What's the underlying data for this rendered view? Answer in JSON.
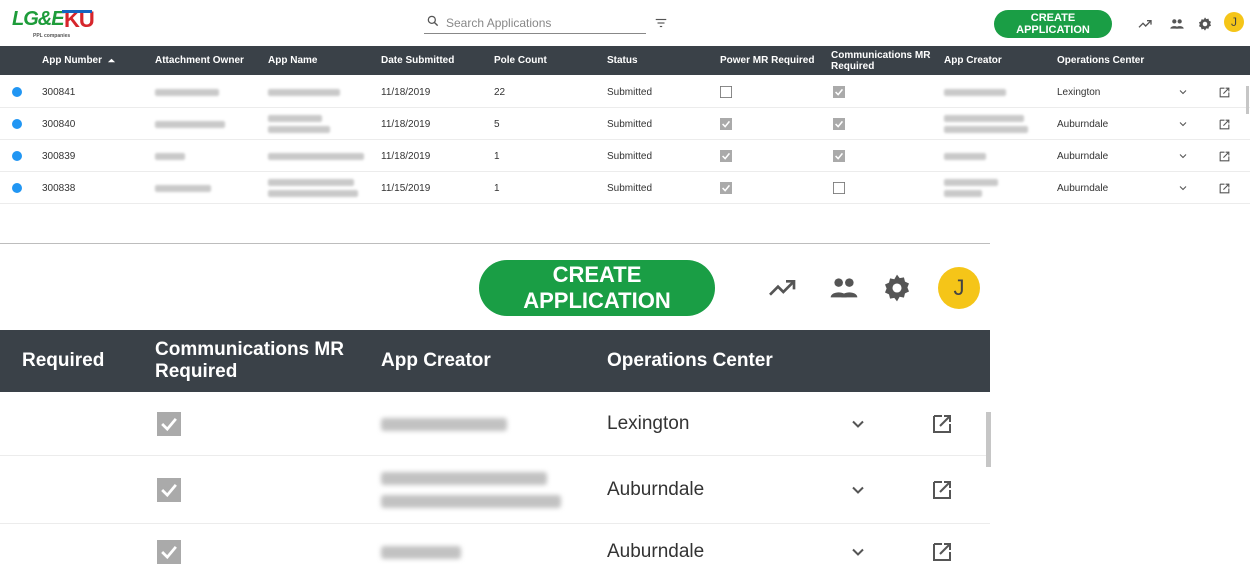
{
  "brand": {
    "logo_primary": "LG&E",
    "logo_secondary": "KU",
    "logo_sub": "PPL companies",
    "green": "#1a9e45",
    "red": "#d6262c"
  },
  "search": {
    "placeholder": "Search Applications",
    "value": ""
  },
  "toolbar": {
    "create_label": "CREATE APPLICATION",
    "avatar_initial": "J",
    "icons": [
      "trending-up-icon",
      "people-icon",
      "settings-icon"
    ]
  },
  "table": {
    "headers": {
      "app_number": "App Number",
      "attachment_owner": "Attachment Owner",
      "app_name": "App Name",
      "date_submitted": "Date Submitted",
      "pole_count": "Pole Count",
      "status": "Status",
      "power_mr": "Power MR Required",
      "comm_mr": "Communications MR Required",
      "app_creator": "App Creator",
      "ops_center": "Operations Center"
    },
    "sorted_column": "App Number",
    "sort_direction": "ascending",
    "rows": [
      {
        "app_number": "300841",
        "date": "11/18/2019",
        "pole_count": "22",
        "status": "Submitted",
        "power_mr": false,
        "comm_mr": true,
        "ops_center": "Lexington"
      },
      {
        "app_number": "300840",
        "date": "11/18/2019",
        "pole_count": "5",
        "status": "Submitted",
        "power_mr": true,
        "comm_mr": true,
        "ops_center": "Auburndale"
      },
      {
        "app_number": "300839",
        "date": "11/18/2019",
        "pole_count": "1",
        "status": "Submitted",
        "power_mr": true,
        "comm_mr": true,
        "ops_center": "Auburndale"
      },
      {
        "app_number": "300838",
        "date": "11/15/2019",
        "pole_count": "1",
        "status": "Submitted",
        "power_mr": true,
        "comm_mr": false,
        "ops_center": "Auburndale"
      }
    ]
  },
  "zoom": {
    "header_required": "Required",
    "header_comm_mr": "Communications MR Required",
    "header_app_creator": "App Creator",
    "header_ops_center": "Operations Center",
    "rows": [
      {
        "comm_mr": true,
        "ops_center": "Lexington"
      },
      {
        "comm_mr": true,
        "ops_center": "Auburndale"
      },
      {
        "comm_mr": true,
        "ops_center": "Auburndale"
      }
    ]
  }
}
